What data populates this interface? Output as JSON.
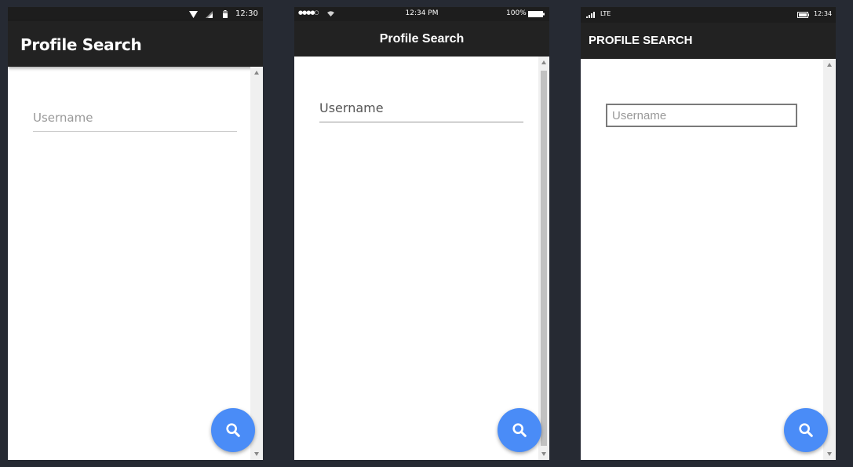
{
  "android": {
    "status": {
      "time": "12:30"
    },
    "title": "Profile Search",
    "username_placeholder": "Username"
  },
  "ios": {
    "status": {
      "carrier": "●●●●○",
      "time": "12:34 PM",
      "battery": "100%"
    },
    "title": "Profile Search",
    "username_placeholder": "Username"
  },
  "windows": {
    "status": {
      "network": "LTE",
      "time": "12:34"
    },
    "title": "PROFILE SEARCH",
    "username_placeholder": "Username"
  },
  "icons": {
    "fab": "search-icon",
    "wifi": "wifi-icon",
    "signal": "signal-icon",
    "battery": "battery-icon"
  },
  "colors": {
    "background": "#262a33",
    "appbar": "#222222",
    "fab": "#4a8cf7"
  }
}
